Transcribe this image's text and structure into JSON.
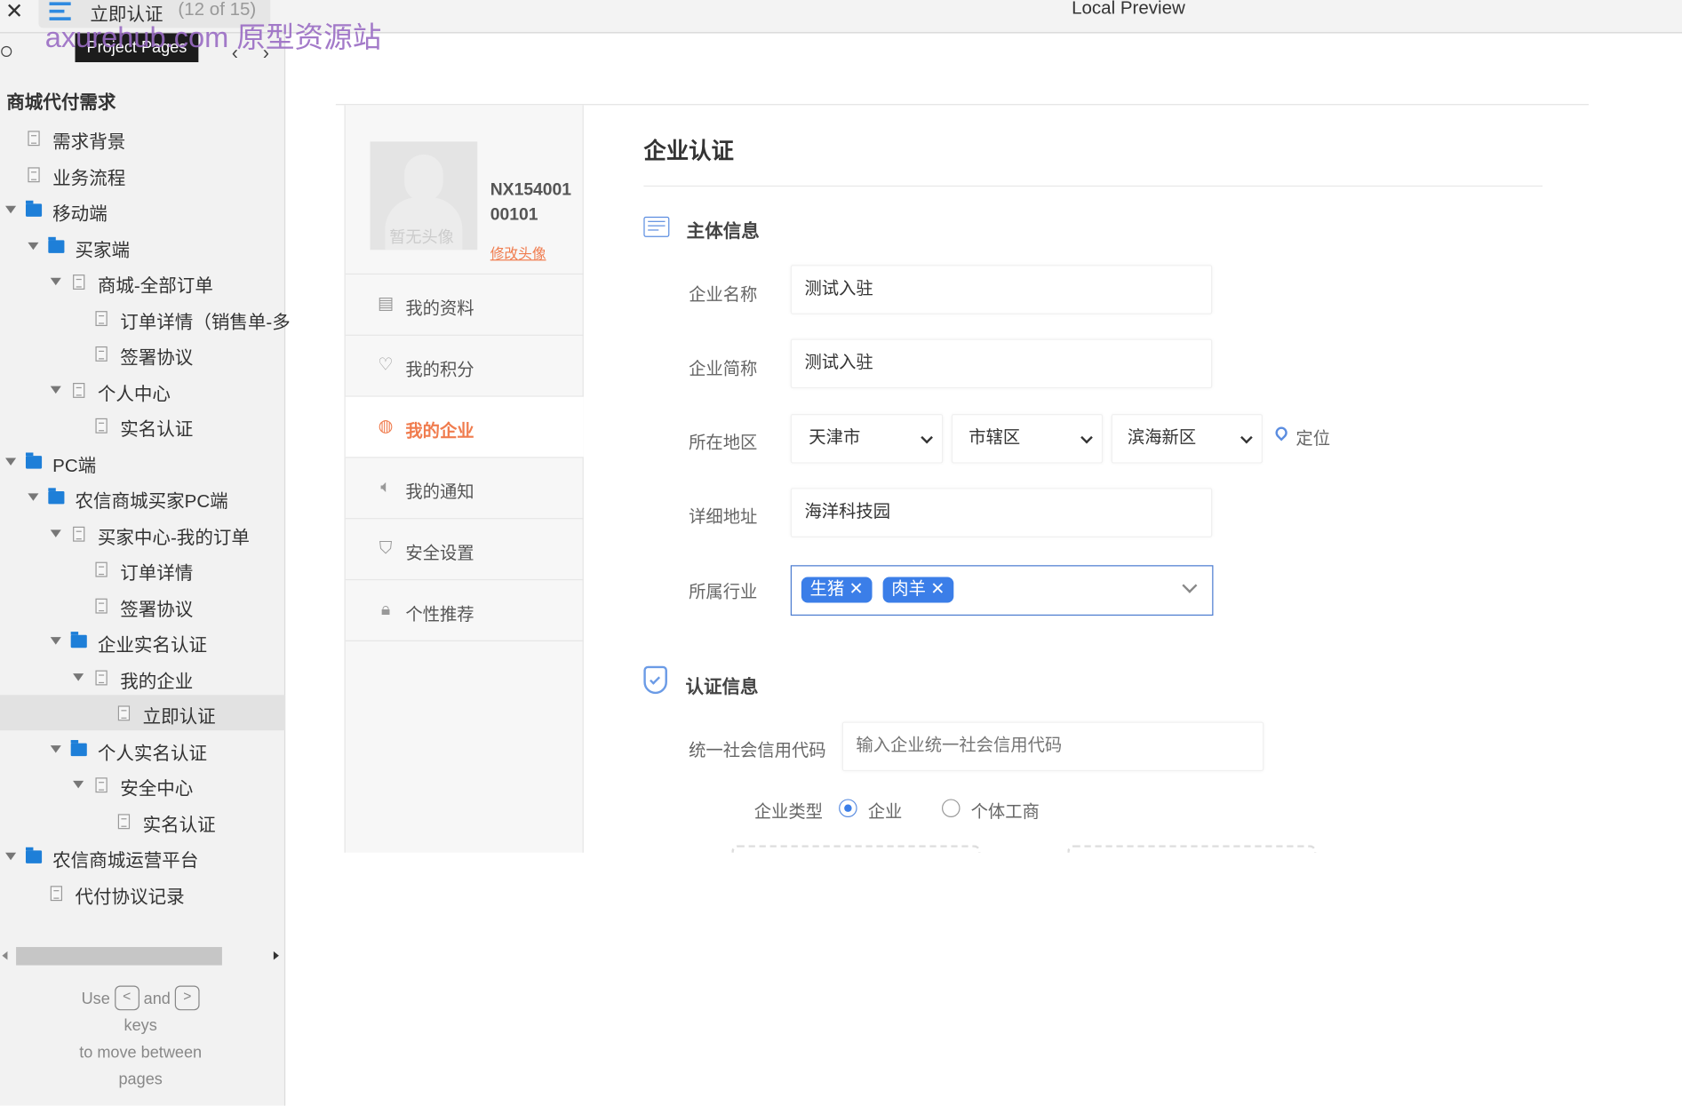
{
  "topbar": {
    "close_icon": "close-icon",
    "menu_icon": "hamburger-icon",
    "page_title": "立即认证",
    "page_count": "(12 of 15)",
    "app_title": "Local Preview"
  },
  "watermark": "axurehub.com 原型资源站",
  "sidebar": {
    "tooltip": "Project Pages",
    "project_title": "商城代付需求",
    "items": [
      {
        "label": "需求背景",
        "level": 0,
        "type": "page",
        "expanded": false
      },
      {
        "label": "业务流程",
        "level": 0,
        "type": "page",
        "expanded": false
      },
      {
        "label": "移动端",
        "level": 0,
        "type": "folder",
        "expanded": true
      },
      {
        "label": "买家端",
        "level": 1,
        "type": "folder",
        "expanded": true
      },
      {
        "label": "商城-全部订单",
        "level": 2,
        "type": "page",
        "expanded": true
      },
      {
        "label": "订单详情（销售单-多",
        "level": 3,
        "type": "page",
        "expanded": false
      },
      {
        "label": "签署协议",
        "level": 3,
        "type": "page",
        "expanded": false
      },
      {
        "label": "个人中心",
        "level": 2,
        "type": "page",
        "expanded": true
      },
      {
        "label": "实名认证",
        "level": 3,
        "type": "page",
        "expanded": false
      },
      {
        "label": "PC端",
        "level": 0,
        "type": "folder",
        "expanded": true
      },
      {
        "label": "农信商城买家PC端",
        "level": 1,
        "type": "folder",
        "expanded": true
      },
      {
        "label": "买家中心-我的订单",
        "level": 2,
        "type": "page",
        "expanded": true
      },
      {
        "label": "订单详情",
        "level": 3,
        "type": "page",
        "expanded": false
      },
      {
        "label": "签署协议",
        "level": 3,
        "type": "page",
        "expanded": false
      },
      {
        "label": "企业实名认证",
        "level": 2,
        "type": "folder",
        "expanded": true
      },
      {
        "label": "我的企业",
        "level": 3,
        "type": "page",
        "expanded": true
      },
      {
        "label": "立即认证",
        "level": 4,
        "type": "page",
        "expanded": false,
        "selected": true
      },
      {
        "label": "个人实名认证",
        "level": 2,
        "type": "folder",
        "expanded": true
      },
      {
        "label": "安全中心",
        "level": 3,
        "type": "page",
        "expanded": true
      },
      {
        "label": "实名认证",
        "level": 4,
        "type": "page",
        "expanded": false
      },
      {
        "label": "农信商城运营平台",
        "level": 0,
        "type": "folder",
        "expanded": true
      },
      {
        "label": "代付协议记录",
        "level": 1,
        "type": "page",
        "expanded": false
      }
    ],
    "footer": {
      "use": "Use",
      "and": "and",
      "key_prev": "<",
      "key_next": ">",
      "keys": "keys",
      "line3": "to move between",
      "line4": "pages"
    }
  },
  "profile": {
    "avatar_text": "暂无头像",
    "user_id_1": "NX154001",
    "user_id_2": "00101",
    "change_avatar": "修改头像"
  },
  "menu": [
    {
      "label": "我的资料",
      "icon": "document-icon",
      "active": false
    },
    {
      "label": "我的积分",
      "icon": "heart-icon",
      "active": false
    },
    {
      "label": "我的企业",
      "icon": "building-icon",
      "active": true
    },
    {
      "label": "我的通知",
      "icon": "speaker-icon",
      "active": false
    },
    {
      "label": "安全设置",
      "icon": "shield-icon",
      "active": false
    },
    {
      "label": "个性推荐",
      "icon": "lock-icon",
      "active": false
    }
  ],
  "form": {
    "title": "企业认证",
    "section1": "主体信息",
    "name_label": "企业名称",
    "name_value": "测试入驻",
    "short_label": "企业简称",
    "short_value": "测试入驻",
    "region_label": "所在地区",
    "province": "天津市",
    "city": "市辖区",
    "district": "滨海新区",
    "locate": "定位",
    "address_label": "详细地址",
    "address_value": "海洋科技园",
    "industry_label": "所属行业",
    "industry_tags": [
      "生猪",
      "肉羊"
    ],
    "section2": "认证信息",
    "credit_label": "统一社会信用代码",
    "credit_placeholder": "输入企业统一社会信用代码",
    "type_label": "企业类型",
    "type_options": [
      "企业",
      "个体工商"
    ],
    "type_selected": "企业"
  },
  "colors": {
    "accent": "#3b7ee8",
    "active_menu": "#f07c4e",
    "watermark": "#9a6cc4"
  }
}
